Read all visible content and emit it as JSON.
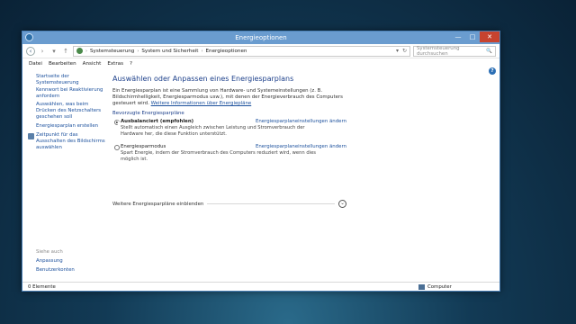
{
  "window": {
    "title": "Energieoptionen"
  },
  "titlebar": {
    "minimize": "—",
    "maximize": "□",
    "close": "✕"
  },
  "nav": {
    "back": "‹",
    "forward": "›",
    "dropdown": "▾",
    "up": "↑"
  },
  "address": {
    "crumbs": [
      "Systemsteuerung",
      "System und Sicherheit",
      "Energieoptionen"
    ],
    "separator": "›",
    "dropdown": "▾",
    "refresh": "↻"
  },
  "search": {
    "placeholder": "Systemsteuerung durchsuchen",
    "icon": "🔍"
  },
  "menu": {
    "items": [
      "Datei",
      "Bearbeiten",
      "Ansicht",
      "Extras",
      "?"
    ]
  },
  "help": {
    "glyph": "?"
  },
  "sidebar": {
    "home": "Startseite der Systemsteuerung",
    "links": [
      "Kennwort bei Reaktivierung anfordern",
      "Auswählen, was beim Drücken des Netzschalters geschehen soll",
      "Energiesparplan erstellen",
      "Zeitpunkt für das Ausschalten des Bildschirms auswählen"
    ],
    "see_also": "Siehe auch",
    "see_also_links": [
      "Anpassung",
      "Benutzerkonten"
    ]
  },
  "main": {
    "heading": "Auswählen oder Anpassen eines Energiesparplans",
    "intro": "Ein Energiesparplan ist eine Sammlung von Hardware- und Systemeinstellungen (z. B. Bildschirmhelligkeit, Energiesparmodus usw.), mit denen der Energieverbrauch des Computers gesteuert wird.",
    "intro_link": "Weitere Informationen über Energiepläne",
    "preferred_label": "Bevorzugte Energiesparpläne",
    "plans": [
      {
        "name": "Ausbalanciert (empfohlen)",
        "link": "Energiesparplaneinstellungen ändern",
        "desc": "Stellt automatisch einen Ausgleich zwischen Leistung und Stromverbrauch der Hardware her, die diese Funktion unterstützt.",
        "selected": true
      },
      {
        "name": "Energiesparmodus",
        "link": "Energiesparplaneinstellungen ändern",
        "desc": "Spart Energie, indem der Stromverbrauch des Computers reduziert wird, wenn dies möglich ist.",
        "selected": false
      }
    ],
    "more_plans": "Weitere Energiesparpläne einblenden",
    "expand_glyph": "⌄"
  },
  "status": {
    "left": "0 Elemente",
    "right": "Computer"
  }
}
